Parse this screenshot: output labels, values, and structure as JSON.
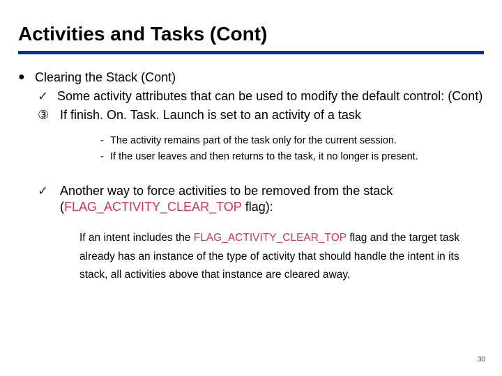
{
  "title": "Activities and Tasks (Cont)",
  "bullets": {
    "b0": "Clearing the Stack (Cont)",
    "b1": "Some activity attributes that can be used to modify the default control: (Cont)",
    "b2": "If finish. On. Task. Launch is set to an activity of a task",
    "dash1": "The activity remains part of the task only for the current session.",
    "dash2": "If the user leaves and then returns to the task, it no longer is present.",
    "b3_pre": "Another way to force activities to be removed from the stack (",
    "b3_flag": "FLAG_ACTIVITY_CLEAR_TOP",
    "b3_post": " flag):",
    "para_pre": "If an intent includes the ",
    "para_flag": "FLAG_ACTIVITY_CLEAR_TOP",
    "para_post": " flag and the target task already has an instance of the type of activity that should handle the intent in its stack, all activities above that instance are cleared away."
  },
  "markers": {
    "dot": "●",
    "check": "✓",
    "circ3": "③",
    "dash": "-"
  },
  "page_number": "30"
}
